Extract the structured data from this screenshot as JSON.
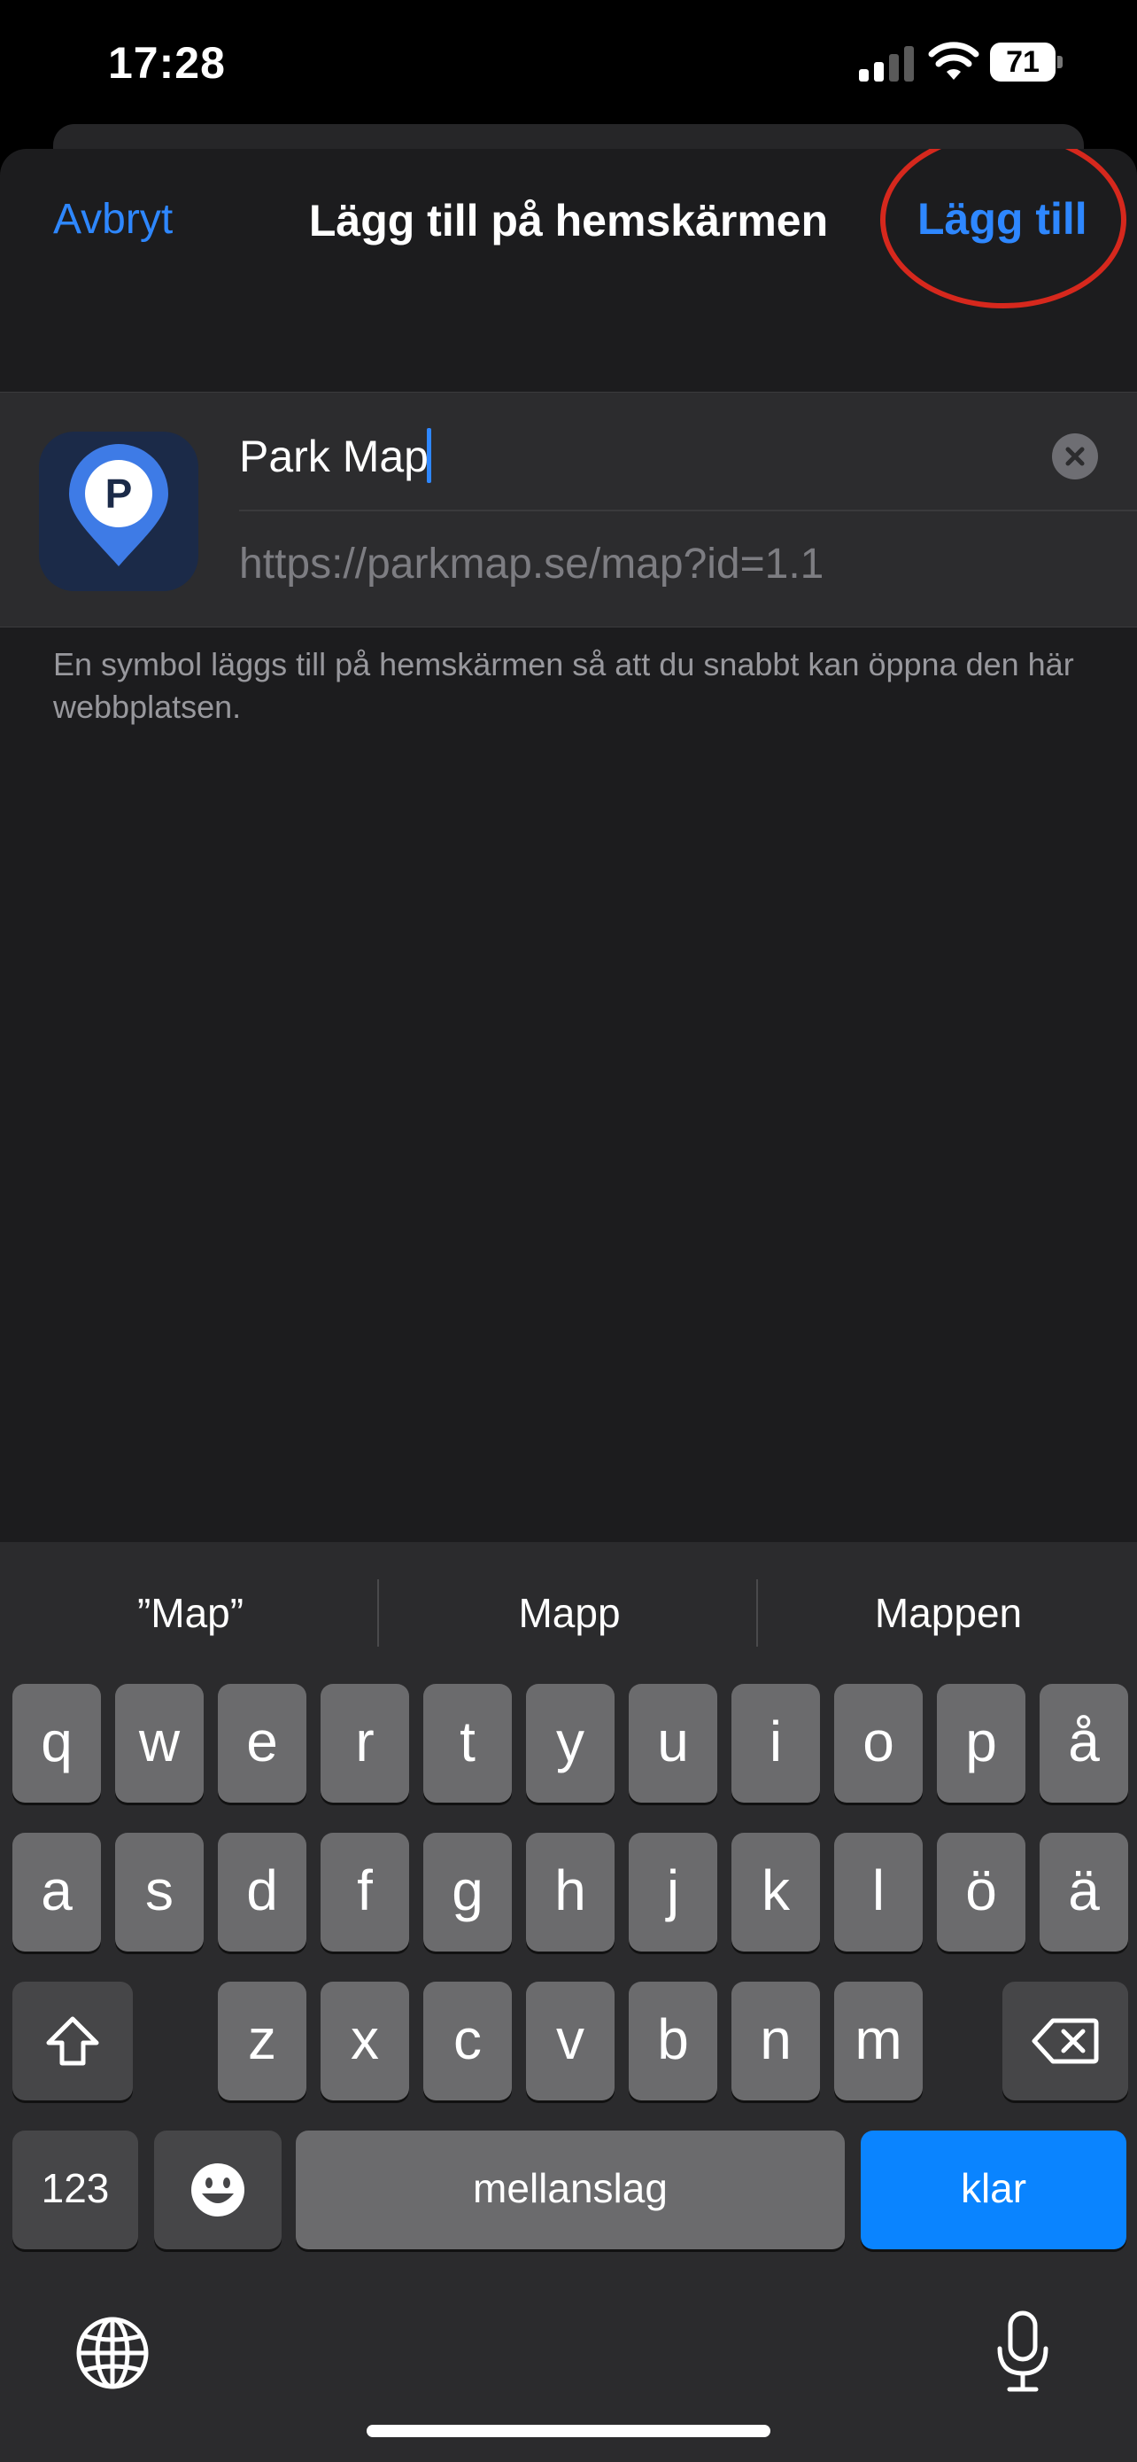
{
  "status": {
    "time": "17:28",
    "battery": "71"
  },
  "nav": {
    "cancel": "Avbryt",
    "title": "Lägg till på hemskärmen",
    "add": "Lägg till"
  },
  "form": {
    "name_value": "Park Map",
    "url": "https://parkmap.se/map?id=1.1",
    "icon_letter": "P"
  },
  "help_text": "En symbol läggs till på hemskärmen så att du snabbt kan öppna den här webbplatsen.",
  "keyboard": {
    "suggestions": [
      "”Map”",
      "Mapp",
      "Mappen"
    ],
    "row1": [
      "q",
      "w",
      "e",
      "r",
      "t",
      "y",
      "u",
      "i",
      "o",
      "p",
      "å"
    ],
    "row2": [
      "a",
      "s",
      "d",
      "f",
      "g",
      "h",
      "j",
      "k",
      "l",
      "ö",
      "ä"
    ],
    "row3": [
      "z",
      "x",
      "c",
      "v",
      "b",
      "n",
      "m"
    ],
    "numbers": "123",
    "space": "mellanslag",
    "done": "klar"
  },
  "colors": {
    "accent": "#2e87ff",
    "highlight": "#d6281d",
    "done_key": "#0a84ff"
  }
}
